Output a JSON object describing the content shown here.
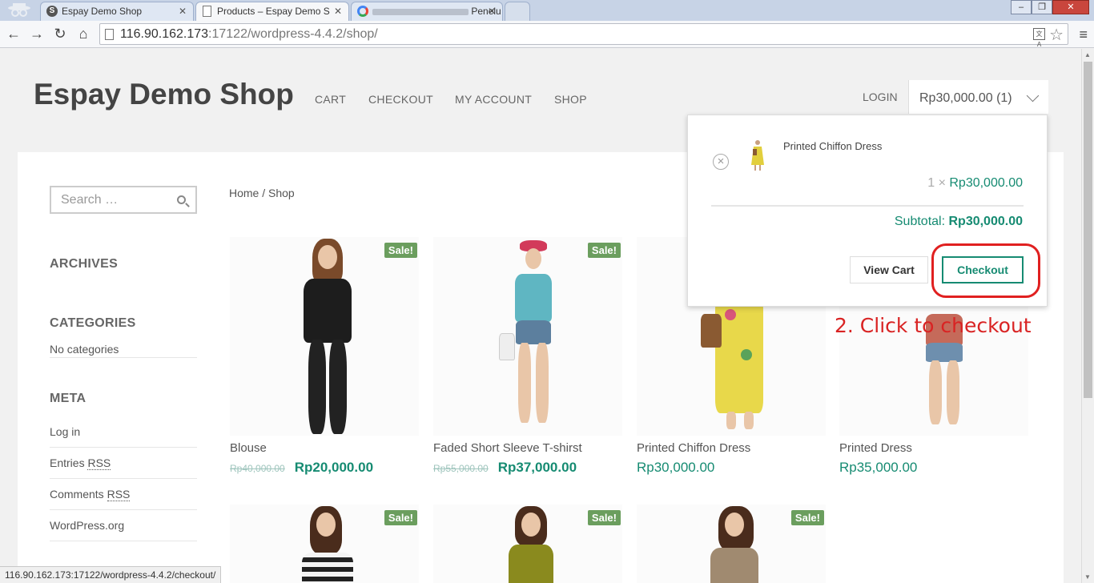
{
  "browser": {
    "tabs": [
      {
        "title": "Espay Demo Shop",
        "icon": "s-site-icon"
      },
      {
        "title": "Products – Espay Demo S",
        "icon": "page-icon"
      },
      {
        "title": "Penelu",
        "icon": "google-icon"
      }
    ],
    "url_host": "116.90.162.173",
    "url_path": ":17122/wordpress-4.4.2/shop/",
    "status_url": "116.90.162.173:17122/wordpress-4.4.2/checkout/"
  },
  "header": {
    "site_title": "Espay Demo Shop",
    "nav": [
      "CART",
      "CHECKOUT",
      "MY ACCOUNT",
      "SHOP"
    ],
    "login": "LOGIN",
    "cart_total": "Rp30,000.00 (1)"
  },
  "sidebar": {
    "search_placeholder": "Search …",
    "archives_title": "ARCHIVES",
    "categories_title": "CATEGORIES",
    "categories_text": "No categories",
    "meta_title": "META",
    "meta_links": [
      "Log in",
      "Entries",
      "Comments",
      "WordPress.org"
    ],
    "rss": "RSS"
  },
  "breadcrumb": "Home / Shop",
  "products": [
    {
      "name": "Blouse",
      "old_price": "Rp40,000.00",
      "price": "Rp20,000.00",
      "sale": "Sale!"
    },
    {
      "name": "Faded Short Sleeve T-shirst",
      "old_price": "Rp55,000.00",
      "price": "Rp37,000.00",
      "sale": "Sale!"
    },
    {
      "name": "Printed Chiffon Dress",
      "old_price": "",
      "price": "Rp30,000.00",
      "sale": ""
    },
    {
      "name": "Printed Dress",
      "old_price": "",
      "price": "Rp35,000.00",
      "sale": ""
    }
  ],
  "row2_sale": "Sale!",
  "minicart": {
    "item_name": "Printed Chiffon Dress",
    "qty": "1 ×",
    "item_price": "Rp30,000.00",
    "subtotal_label": "Subtotal:",
    "subtotal": "Rp30,000.00",
    "view_cart": "View Cart",
    "checkout": "Checkout"
  },
  "annotation": "2. Click to checkout",
  "colors": {
    "accent": "#168b72",
    "sale_badge": "#6b9e5e",
    "annotation": "#d92323"
  }
}
